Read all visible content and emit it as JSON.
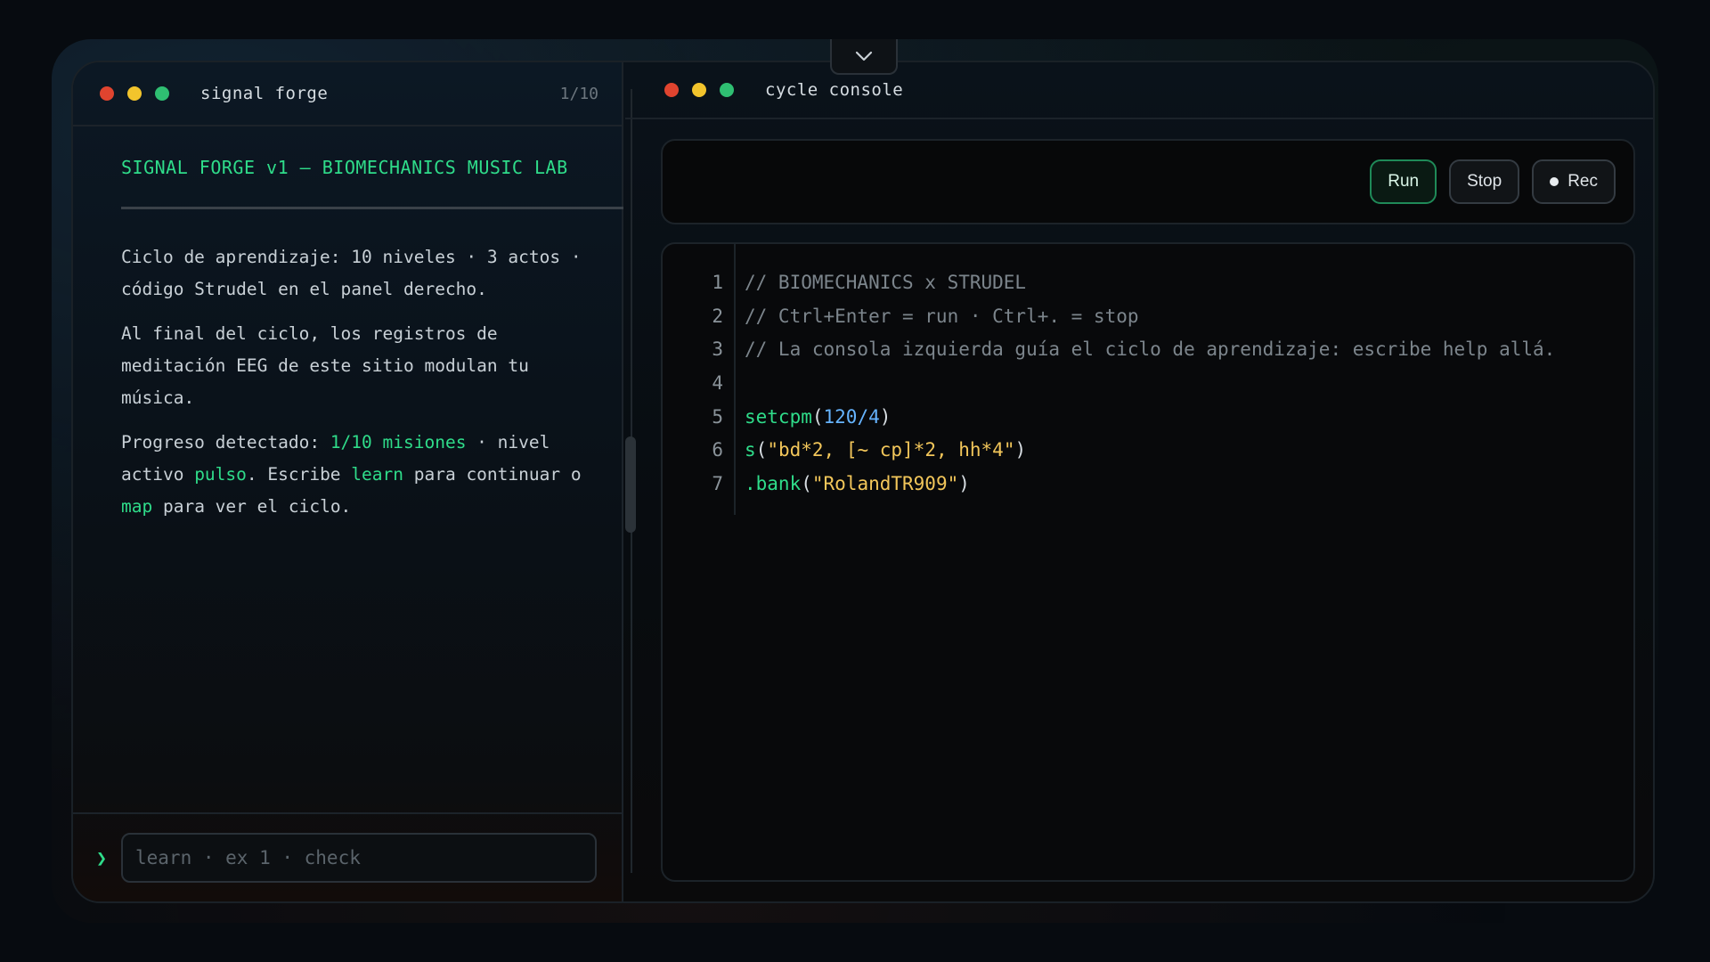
{
  "left_window": {
    "title": "signal forge",
    "counter": "1/10",
    "lab_title": "SIGNAL FORGE v1 — BIOMECHANICS MUSIC LAB",
    "para1": "Ciclo de aprendizaje: 10 niveles · 3 actos · código Strudel en el panel derecho.",
    "para2": "Al final del ciclo, los registros de meditación EEG de este sitio modulan tu música.",
    "para3": {
      "t1": "Progreso detectado: ",
      "h1": "1/10 misiones",
      "t2": " · nivel activo ",
      "h2": "pulso",
      "t3": ". Escribe ",
      "h3": "learn",
      "t4": " para continuar o ",
      "h4": "map",
      "t5": " para ver el ciclo."
    },
    "prompt_symbol": "❯",
    "input_placeholder": "learn · ex 1 · check"
  },
  "right_window": {
    "title": "cycle console",
    "buttons": {
      "run": "Run",
      "stop": "Stop",
      "rec": "Rec"
    }
  },
  "editor": {
    "line_numbers": [
      "1",
      "2",
      "3",
      "4",
      "5",
      "6",
      "7"
    ],
    "l1": "// BIOMECHANICS x STRUDEL",
    "l2": "// Ctrl+Enter = run · Ctrl+. = stop",
    "l3": "// La consola izquierda guía el ciclo de aprendizaje: escribe help allá.",
    "l5": {
      "fn": "setcpm",
      "open": "(",
      "num": "120/4",
      "close": ")"
    },
    "l6": {
      "fn": "s",
      "open": "(",
      "str": "\"bd*2, [~ cp]*2, hh*4\"",
      "close": ")"
    },
    "l7": {
      "fn": ".bank",
      "open": "(",
      "str": "\"RolandTR909\"",
      "close": ")"
    }
  },
  "icons": {
    "collapse": "chevron-down-icon",
    "traffic_lights": [
      "close-dot",
      "minimize-dot",
      "maximize-dot"
    ]
  },
  "colors": {
    "accent": "#2fdc8a",
    "number": "#66b4ff",
    "string": "#f2c65a",
    "comment": "#7c858c",
    "close": "#e0442f",
    "minimize": "#f2c42c",
    "maximize": "#2fbf72"
  }
}
